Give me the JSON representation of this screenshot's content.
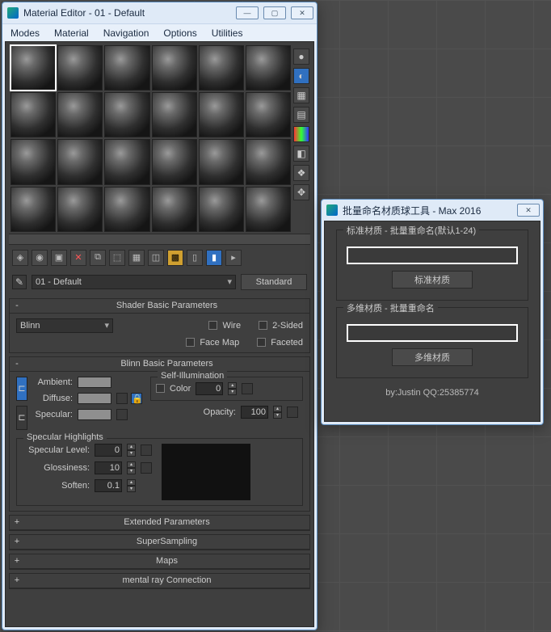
{
  "materialEditor": {
    "title": "Material Editor - 01 - Default",
    "menus": [
      "Modes",
      "Material",
      "Navigation",
      "Options",
      "Utilities"
    ],
    "sideToolIcons": [
      "sphere-sample",
      "checker-bg",
      "highlight-preview",
      "color-swatch",
      "eraser",
      "assign-material",
      "pick-material"
    ],
    "toolbarIcons": [
      "get-material",
      "put-to-scene",
      "assign-selection",
      "delete",
      "reset",
      "make-unique",
      "put-to-library",
      "material-effects",
      "show-map",
      "show-end-result",
      "go-parent",
      "go-sibling"
    ],
    "activeMaterialName": "01 - Default",
    "typeButton": "Standard",
    "rollouts": {
      "shaderBasic": {
        "title": "Shader Basic Parameters",
        "shader": "Blinn",
        "checks": {
          "wire": "Wire",
          "twoSided": "2-Sided",
          "faceMap": "Face Map",
          "faceted": "Faceted"
        }
      },
      "blinnBasic": {
        "title": "Blinn Basic Parameters",
        "selfIllum": "Self-Illumination",
        "colorLabel": "Color",
        "colorVal": "0",
        "ambient": "Ambient:",
        "diffuse": "Diffuse:",
        "specular": "Specular:",
        "opacityLabel": "Opacity:",
        "opacityVal": "100",
        "specHighlights": "Specular Highlights",
        "specLevelLabel": "Specular Level:",
        "specLevelVal": "0",
        "glossLabel": "Glossiness:",
        "glossVal": "10",
        "softenLabel": "Soften:",
        "softenVal": "0.1"
      },
      "collapsed": [
        "Extended Parameters",
        "SuperSampling",
        "Maps",
        "mental ray Connection"
      ]
    }
  },
  "renameTool": {
    "title": "批量命名材质球工具 - Max 2016",
    "std": {
      "legend": "标准材质 - 批量重命名(默认1-24)",
      "button": "标准材质"
    },
    "multi": {
      "legend": "多维材质 - 批量重命名",
      "button": "多维材质"
    },
    "credit": "by:Justin QQ:25385774"
  }
}
